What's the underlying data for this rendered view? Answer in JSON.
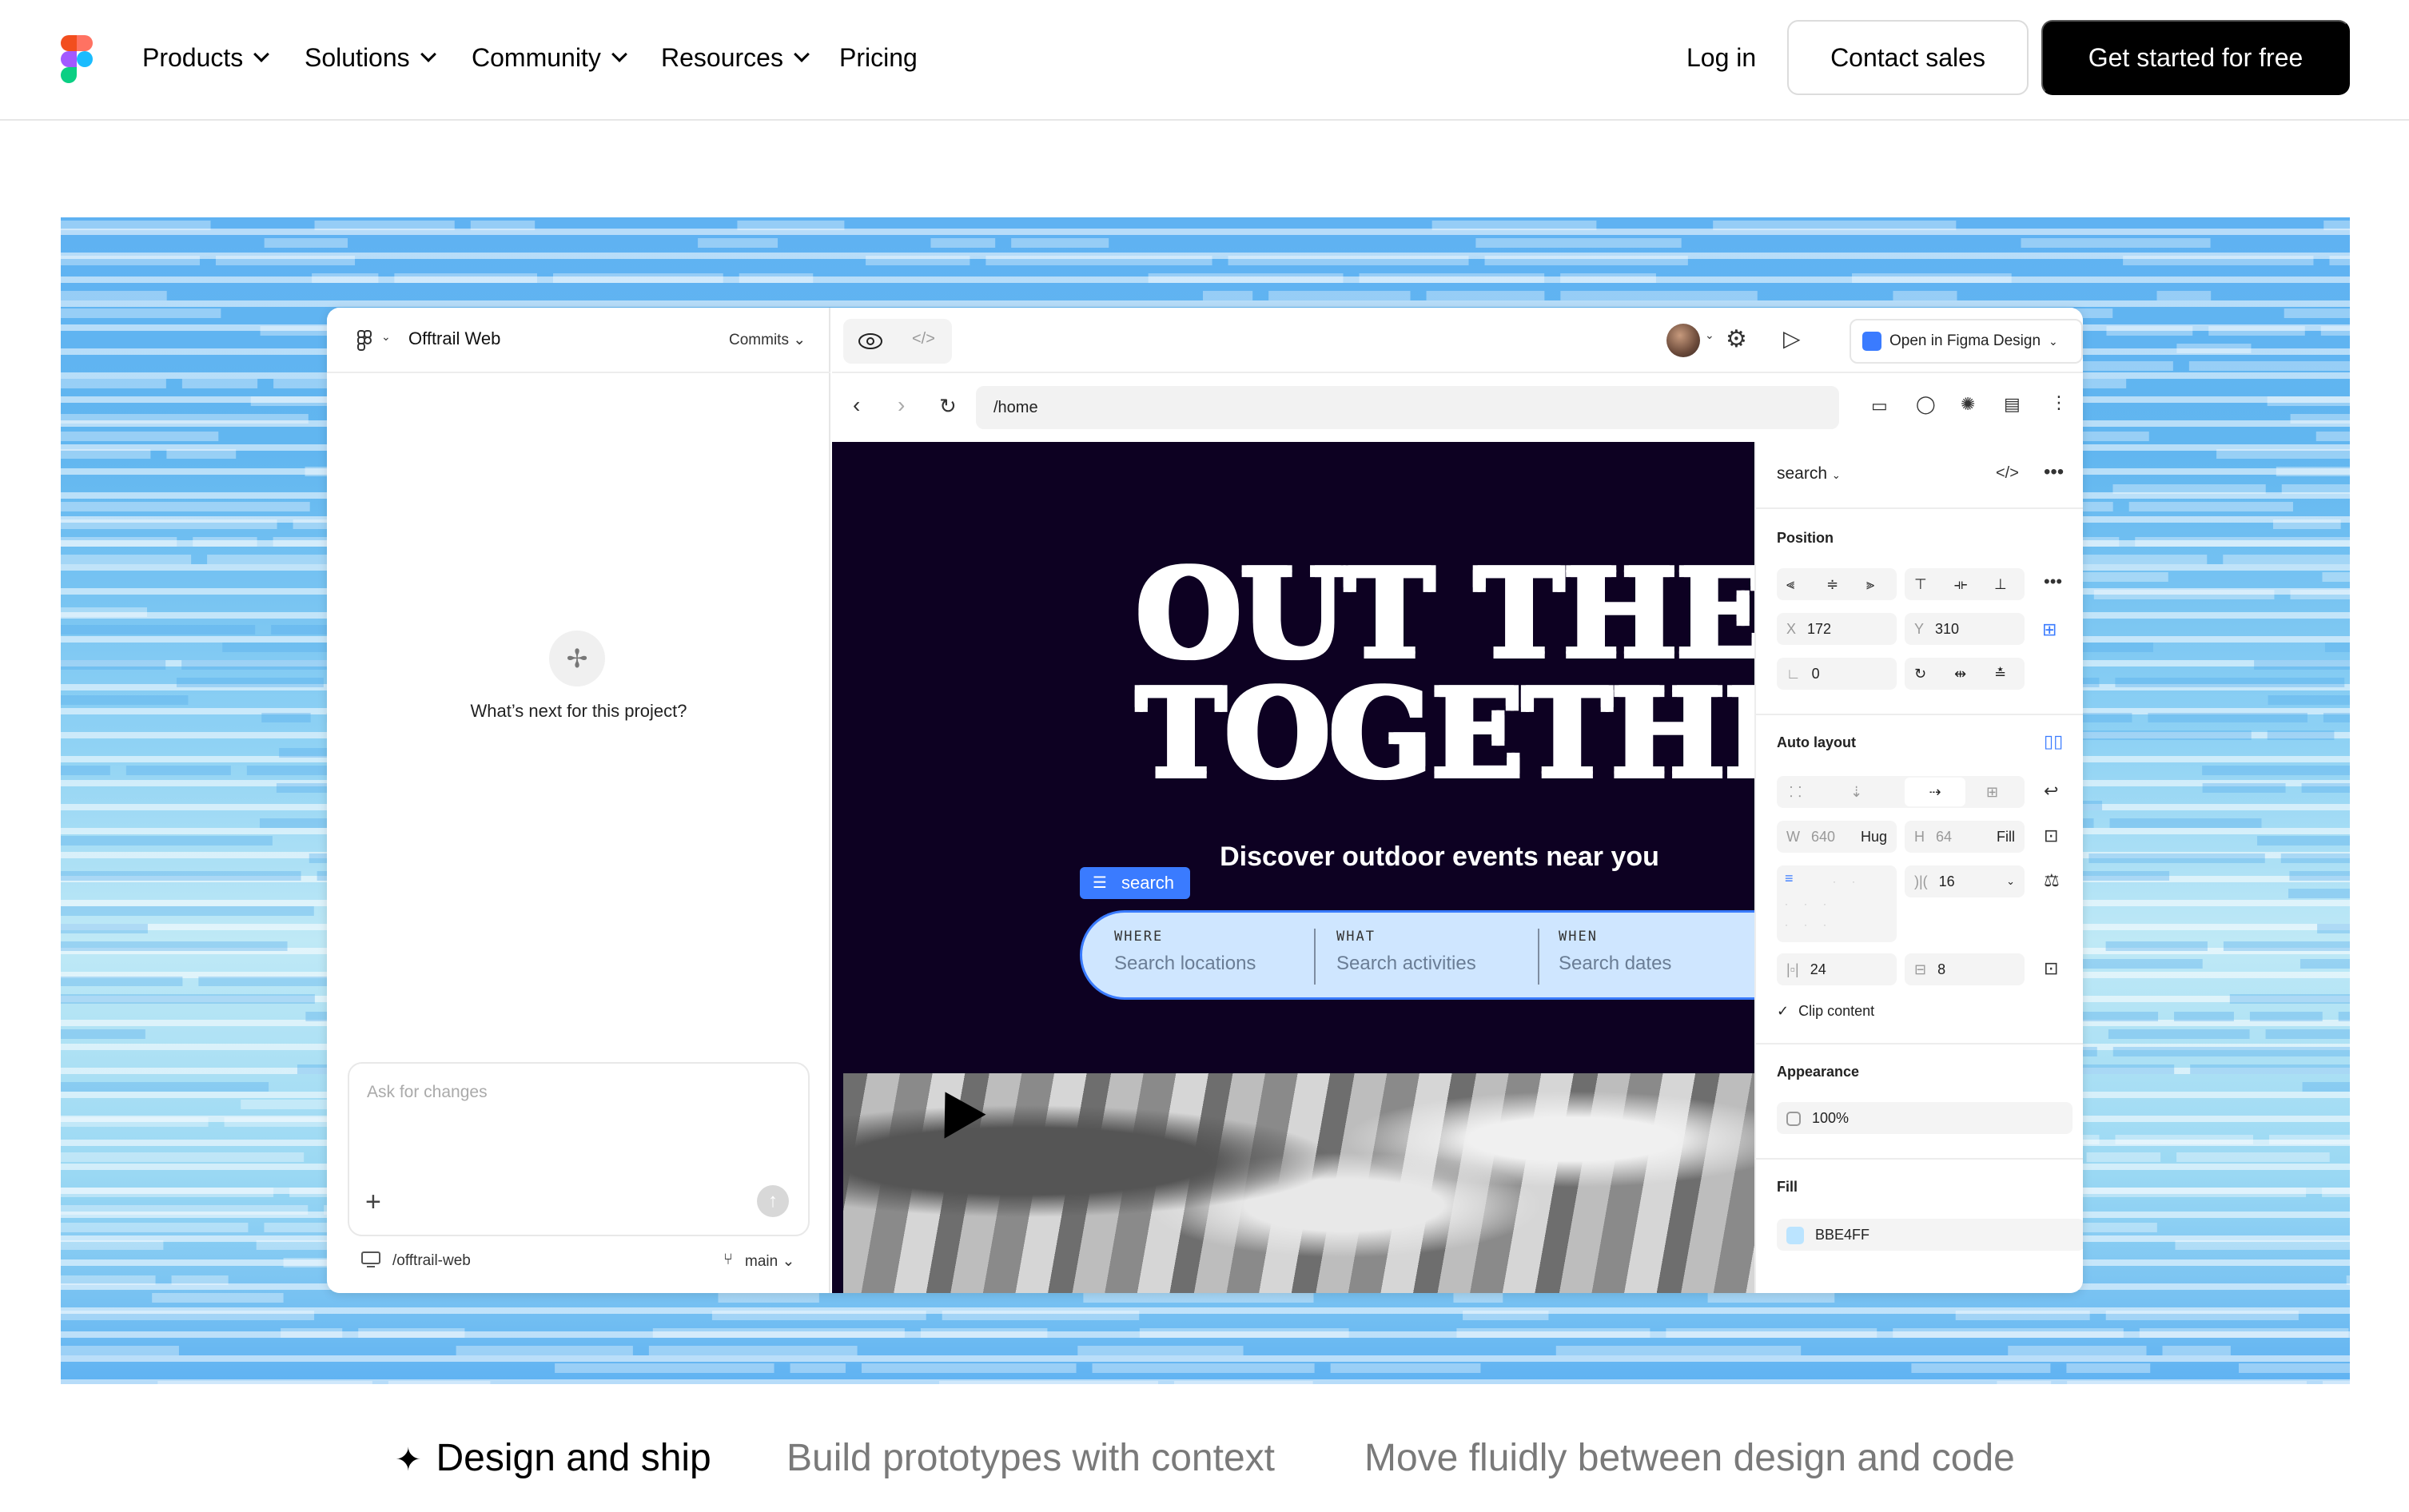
{
  "nav": {
    "items": [
      {
        "label": "Products",
        "dropdown": true
      },
      {
        "label": "Solutions",
        "dropdown": true
      },
      {
        "label": "Community",
        "dropdown": true
      },
      {
        "label": "Resources",
        "dropdown": true
      },
      {
        "label": "Pricing",
        "dropdown": false
      }
    ],
    "login": "Log in",
    "contact_sales": "Contact sales",
    "get_started": "Get started for free"
  },
  "app": {
    "project_title": "Offtrail Web",
    "commits_label": "Commits",
    "prompt_question": "What’s next for this project?",
    "ask_placeholder": "Ask for changes",
    "repo_path": "/offtrail-web",
    "branch": "main",
    "open_in_figma": "Open in Figma Design",
    "url": "/home",
    "canvas": {
      "headline_line1": "OUT THERE",
      "headline_line2": "TOGETHER",
      "subheadline": "Discover outdoor events near you",
      "selection_tag": "search",
      "search_fields": [
        {
          "label": "WHERE",
          "placeholder": "Search locations"
        },
        {
          "label": "WHAT",
          "placeholder": "Search activities"
        },
        {
          "label": "WHEN",
          "placeholder": "Search dates"
        }
      ]
    },
    "properties": {
      "layer_name": "search",
      "position_title": "Position",
      "x_label": "X",
      "x_value": "172",
      "y_label": "Y",
      "y_value": "310",
      "rotation": "0",
      "auto_layout_title": "Auto layout",
      "w_label": "W",
      "w_value": "640",
      "w_mode": "Hug",
      "h_label": "H",
      "h_value": "64",
      "h_mode": "Fill",
      "gap": "16",
      "padding_h": "24",
      "padding_v": "8",
      "clip_content": "Clip content",
      "appearance_title": "Appearance",
      "opacity": "100%",
      "fill_title": "Fill",
      "fill_hex": "BBE4FF"
    }
  },
  "tabs": [
    {
      "label": "Design and ship",
      "active": true
    },
    {
      "label": "Build prototypes with context",
      "active": false
    },
    {
      "label": "Move fluidly between design and code",
      "active": false
    }
  ],
  "colors": {
    "brand_red": "#f24e1e",
    "brand_orange": "#ff7262",
    "brand_purple": "#a259ff",
    "brand_blue": "#1abcfe",
    "brand_green": "#0acf83",
    "hero_blue": "#5fb2f2",
    "selection_blue": "#3a7bff",
    "fill_swatch": "#BBE4FF"
  }
}
